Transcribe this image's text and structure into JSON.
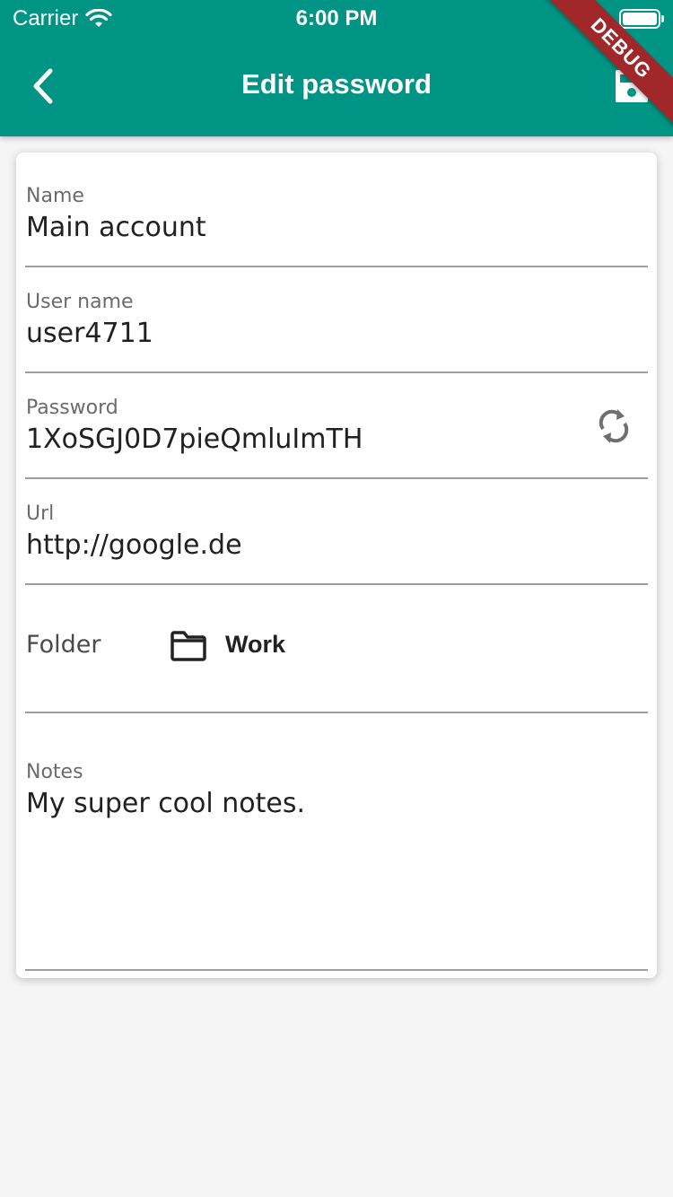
{
  "status_bar": {
    "carrier": "Carrier",
    "time": "6:00 PM"
  },
  "appbar": {
    "title": "Edit password",
    "back_icon": "chevron-left-icon",
    "save_icon": "floppy-disk-icon",
    "debug_banner": "DEBUG",
    "color": "#009484"
  },
  "form": {
    "name": {
      "label": "Name",
      "value": "Main account"
    },
    "username": {
      "label": "User name",
      "value": "user4711"
    },
    "password": {
      "label": "Password",
      "value": "1XoSGJ0D7pieQmluImTH",
      "action_icon": "refresh-icon"
    },
    "url": {
      "label": "Url",
      "value": "http://google.de"
    },
    "folder": {
      "label": "Folder",
      "value": "Work",
      "icon": "folder-icon"
    },
    "notes": {
      "label": "Notes",
      "value": "My super cool notes."
    }
  }
}
